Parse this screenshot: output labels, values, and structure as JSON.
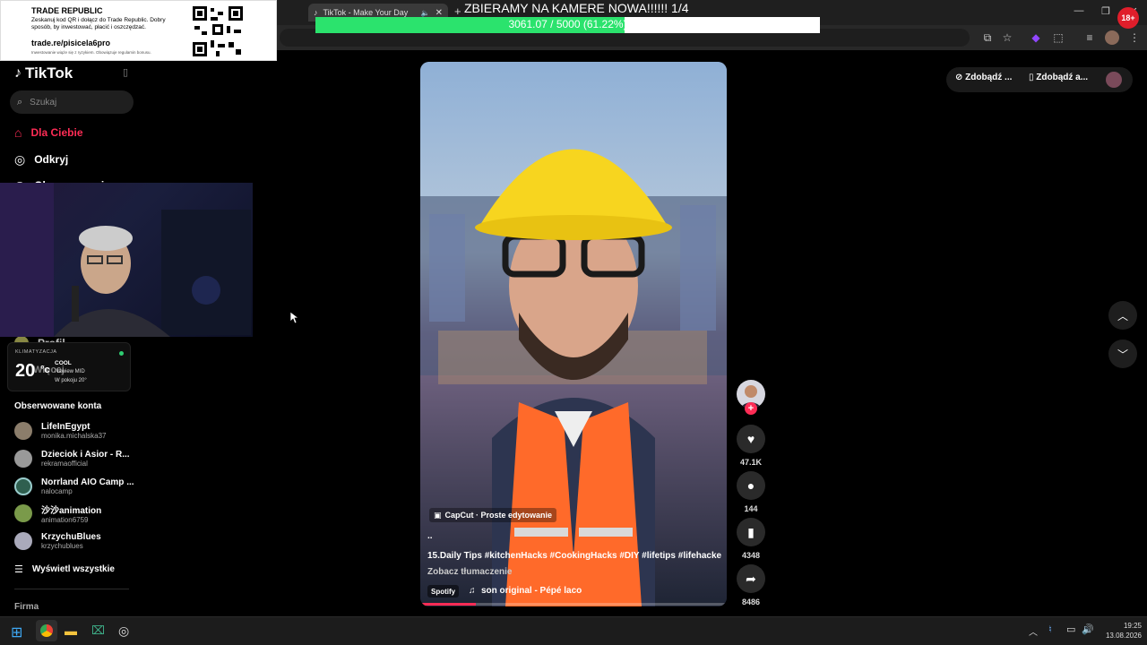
{
  "browser": {
    "tabs": [
      {
        "label": "TikTok - Make Your Day",
        "active": true
      }
    ],
    "new_tab": "+"
  },
  "overlay": {
    "trade": {
      "brand": "TRADE REPUBLIC",
      "text": "Zeskanuj kod QR i dołącz do Trade Republic. Dobry sposób, by inwestować, płacić i oszczędzać.",
      "link": "trade.re/pisicela6pro",
      "note": "Inwestowanie wiąże się z ryzykiem. Obowiązuje regulamin bonusu."
    },
    "goal": {
      "title": "ZBIERAMY NA KAMERE NOWA!!!!!! 1/4",
      "progress_text": "3061.07 / 5000 (61.22%)",
      "progress": 0.6122
    },
    "climate": {
      "label": "KLIMATYZACJA",
      "temp": "20",
      "unit": "°c",
      "mode": "COOL",
      "fan": "Nawiew MID",
      "room": "W pokoju 20°"
    }
  },
  "sidebar": {
    "logo": "TikTok",
    "search_placeholder": "Szukaj",
    "nav": [
      {
        "label": "Dla Ciebie",
        "active": true
      },
      {
        "label": "Odkryj"
      },
      {
        "label": "Obserwowani"
      }
    ],
    "profile_label": "Profil",
    "more_label": "Więcej",
    "following_title": "Obserwowane konta",
    "accounts": [
      {
        "name": "LifeInEgypt",
        "handle": "monika.michalska37"
      },
      {
        "name": "Dzieciok i Asior - R...",
        "handle": "rekramaofficial"
      },
      {
        "name": "Norrland AIO Camp ...",
        "handle": "nalocamp"
      },
      {
        "name": "沙沙animation",
        "handle": "animation6759"
      },
      {
        "name": "KrzychuBlues",
        "handle": "krzychublues"
      }
    ],
    "show_all": "Wyświetl wszystkie",
    "footer_title": "Firma"
  },
  "video": {
    "capcut": "CapCut · Proste edytowanie",
    "ellipsis": "..",
    "caption": "15.Daily Tips #kitchenHacks #CookingHacks #DIY #lifetips #lifehacke",
    "translate": "Zobacz tłumaczenie",
    "spotify": "Spotify",
    "sound": "son original - Pépé laco",
    "progress": 0.18
  },
  "actions": {
    "likes": "47.1K",
    "comments": "144",
    "saves": "4348",
    "shares": "8486"
  },
  "top_right": {
    "btn1": "Zdobądź ...",
    "btn2": "Zdobądź a..."
  },
  "taskbar": {
    "time": "19:25",
    "date": "13.08.2026"
  },
  "age_badge": "18+"
}
